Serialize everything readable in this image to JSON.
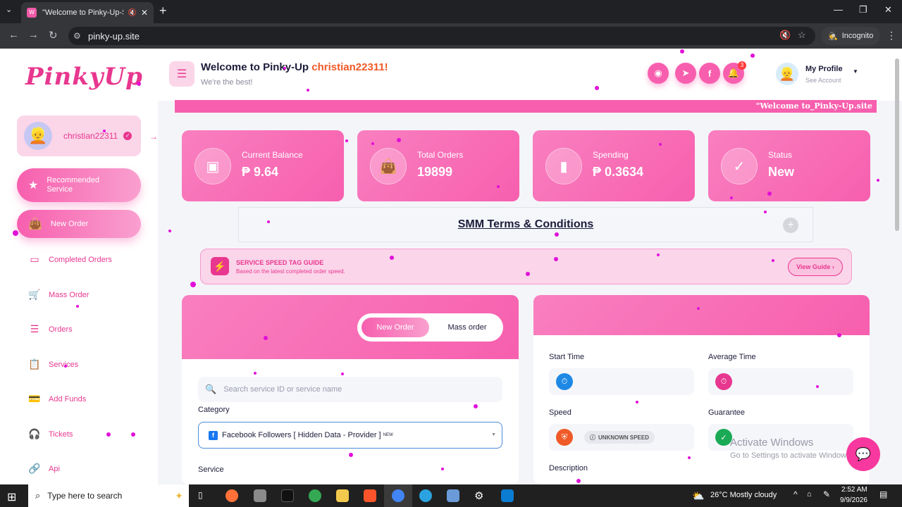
{
  "browser": {
    "tab_title": "\"Welcome to Pinky-Up-Site",
    "url": "pinky-up.site",
    "incognito_label": "Incognito"
  },
  "sidebar": {
    "logo": "PinkyUp",
    "username": "christian22311",
    "recommended": "Recommended Service",
    "new_order": "New Order",
    "items": [
      {
        "label": "Completed Orders",
        "icon": "box-icon"
      },
      {
        "label": "Mass Order",
        "icon": "cart-icon"
      },
      {
        "label": "Orders",
        "icon": "server-icon"
      },
      {
        "label": "Services",
        "icon": "clipboard-icon"
      },
      {
        "label": "Add Funds",
        "icon": "card-icon"
      },
      {
        "label": "Tickets",
        "icon": "headset-icon"
      },
      {
        "label": "Api",
        "icon": "link-icon"
      }
    ]
  },
  "header": {
    "welcome_prefix": "Welcome to Pinky-Up ",
    "welcome_user": "christian22311!",
    "subtitle": "We're the best!",
    "notification_count": "3",
    "profile_title": "My Profile",
    "profile_sub": "See Account"
  },
  "marquee": "\"Welcome to_Pinky-Up.site",
  "stats": [
    {
      "label": "Current Balance",
      "value": "₱ 9.64",
      "icon": "wallet-icon"
    },
    {
      "label": "Total Orders",
      "value": "19899",
      "icon": "bag-icon"
    },
    {
      "label": "Spending",
      "value": "₱ 0.3634",
      "icon": "chart-icon"
    },
    {
      "label": "Status",
      "value": "New",
      "icon": "check-circle-icon"
    }
  ],
  "terms": "SMM Terms & Conditions",
  "guide": {
    "title": "SERVICE SPEED TAG GUIDE",
    "subtitle": "Based on the latest completed order speed.",
    "button": "View Guide"
  },
  "order_form": {
    "tab_new": "New Order",
    "tab_mass": "Mass order",
    "search_placeholder": "Search service ID or service name",
    "category_label": "Category",
    "category_value": "Facebook Followers [ Hidden Data - Provider ]",
    "category_badge": "NEW",
    "service_label": "Service"
  },
  "details": {
    "start_time": "Start Time",
    "average_time": "Average Time",
    "speed": "Speed",
    "speed_tag": "UNKNOWN SPEED",
    "guarantee": "Guarantee",
    "description": "Description"
  },
  "activation": {
    "line1": "Activate Windows",
    "line2": "Go to Settings to activate Windows."
  },
  "taskbar": {
    "search": "Type here to search",
    "weather": "26°C  Mostly cloudy",
    "time": "2:52 AM",
    "date": "9/9/2026"
  },
  "colors": {
    "accent": "#f75fae",
    "accent_dark": "#e8378f"
  }
}
